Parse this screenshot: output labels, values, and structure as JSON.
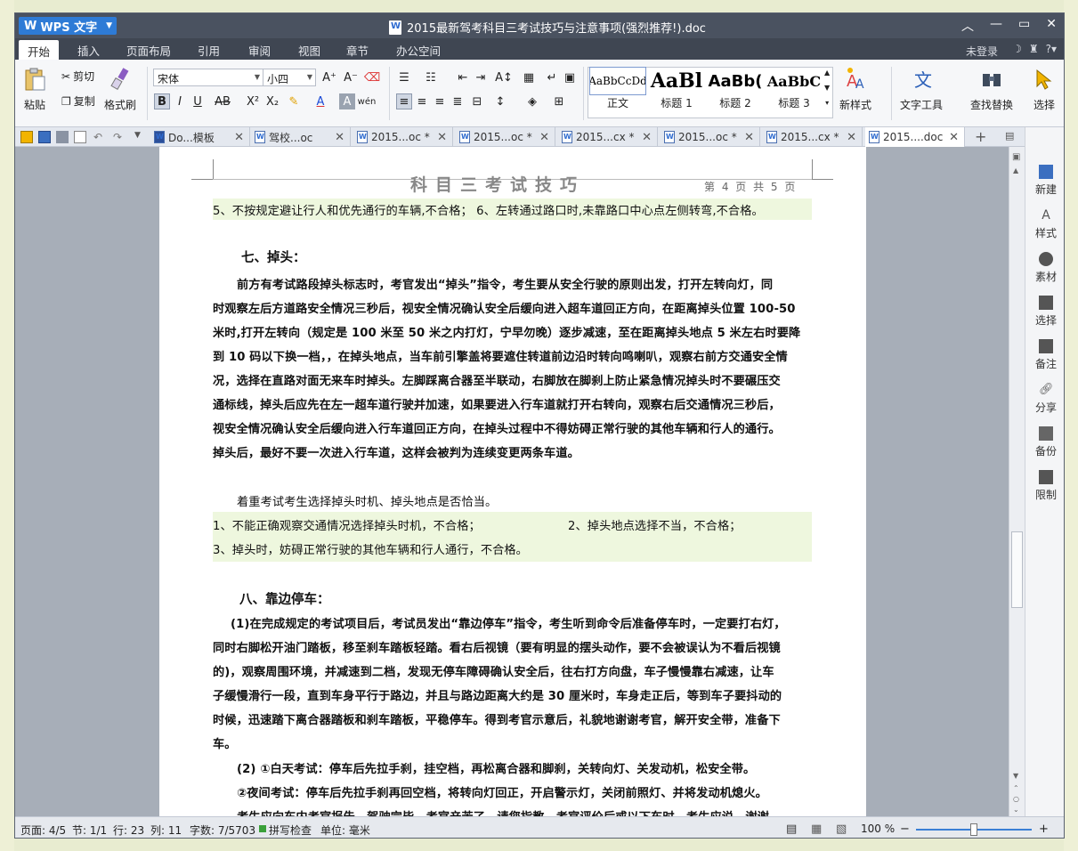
{
  "window": {
    "app_name": "WPS 文字",
    "doc_title": "2015最新驾考科目三考试技巧与注意事项(强烈推荐!).doc"
  },
  "menu": {
    "tabs": [
      "开始",
      "插入",
      "页面布局",
      "引用",
      "审阅",
      "视图",
      "章节",
      "办公空间"
    ],
    "login": "未登录"
  },
  "ribbon": {
    "paste": "粘贴",
    "cut": "剪切",
    "copy": "复制",
    "format_painter": "格式刷",
    "font_name": "宋体",
    "font_size": "小四",
    "styles": [
      {
        "preview": "AaBbCcDd",
        "name": "正文"
      },
      {
        "preview": "AaBl",
        "name": "标题 1"
      },
      {
        "preview": "AaBb(",
        "name": "标题 2"
      },
      {
        "preview": "AaBbC",
        "name": "标题 3"
      }
    ],
    "new_style": "新样式",
    "text_tools": "文字工具",
    "find_replace": "查找替换",
    "select": "选择"
  },
  "doc_tabs": [
    {
      "label": "Do...模板",
      "active": false
    },
    {
      "label": "驾校...oc",
      "active": false
    },
    {
      "label": "2015...oc *",
      "active": false
    },
    {
      "label": "2015...oc *",
      "active": false
    },
    {
      "label": "2015...cx *",
      "active": false
    },
    {
      "label": "2015...oc *",
      "active": false
    },
    {
      "label": "2015...cx *",
      "active": false
    },
    {
      "label": "2015....doc",
      "active": true
    }
  ],
  "side_panel": [
    "新建",
    "样式",
    "素材",
    "选择",
    "备注",
    "分享",
    "备份",
    "限制"
  ],
  "page": {
    "header_title": "科目三考试技巧",
    "header_page": "第 4 页 共 5 页",
    "lines": [
      "5、不按规定避让行人和优先通行的车辆,不合格；  6、左转通过路口时,未靠路口中心点左侧转弯,不合格。",
      "七、掉头：",
      "前方有考试路段掉头标志时，考官发出“掉头”指令，考生要从安全行驶的原则出发，打开左转向灯，同",
      "时观察左后方道路安全情况三秒后，视安全情况确认安全后缓向进入超车道回正方向，在距离掉头位置 100-50",
      "米时,打开左转向（规定是 100 米至 50 米之内打灯，宁早勿晚）逐步减速，至在距离掉头地点 5 米左右时要降",
      "到 10 码以下换一档，，在掉头地点，当车前引擎盖将要遮住转道前边沿时转向鸣喇叭，观察右前方交通安全情",
      "况，选择在直路对面无来车时掉头。左脚踩离合器至半联动，右脚放在脚刹上防止紧急情况掉头时不要碾压交",
      "通标线，掉头后应先在左一超车道行驶并加速，如果要进入行车道就打开右转向，观察右后交通情况三秒后，",
      "视安全情况确认安全后缓向进入行车道回正方向，在掉头过程中不得妨碍正常行驶的其他车辆和行人的通行。",
      "掉头后，最好不要一次进入行车道，这样会被判为连续变更两条车道。",
      "着重考试考生选择掉头时机、掉头地点是否恰当。",
      "1、不能正确观察交通情况选择掉头时机，不合格；",
      "2、掉头地点选择不当，不合格；",
      "3、掉头时，妨碍正常行驶的其他车辆和行人通行，不合格。",
      "八、靠边停车：",
      "(1)在完成规定的考试项目后，考试员发出“靠边停车”指令，考生听到命令后准备停车时，一定要打右灯，",
      "同时右脚松开油门踏板，移至刹车踏板轻踏。看右后视镜（要有明显的摆头动作，要不会被误认为不看后视镜",
      "的)，观察周围环境，并减速到二档，发现无停车障碍确认安全后，往右打方向盘，车子慢慢靠右减速，让车",
      "子缓慢滑行一段，直到车身平行于路边，并且与路边距离大约是 30 厘米时，车身走正后，等到车子要抖动的",
      "时候，迅速踏下离合器踏板和刹车踏板，平稳停车。得到考官示意后，礼貌地谢谢考官，解开安全带，准备下",
      "车。",
      "(2) ①白天考试：停车后先拉手刹，挂空档，再松离合器和脚刹，关转向灯、关发动机，松安全带。",
      "②夜间考试：停车后先拉手刹再回空档，将转向灯回正，开启警示灯，关闭前照灯、并将发动机熄火。",
      "考生应向车内考官报告，驾驶完毕，考官辛苦了，请您指教。考官评价后或以下车时，考生应说，谢谢"
    ]
  },
  "status": {
    "page": "页面: 4/5",
    "section": "节: 1/1",
    "row": "行: 23",
    "col": "列: 11",
    "words": "字数: 7/5703",
    "spell": "拼写检查",
    "unit": "单位: 毫米",
    "zoom": "100 %"
  }
}
